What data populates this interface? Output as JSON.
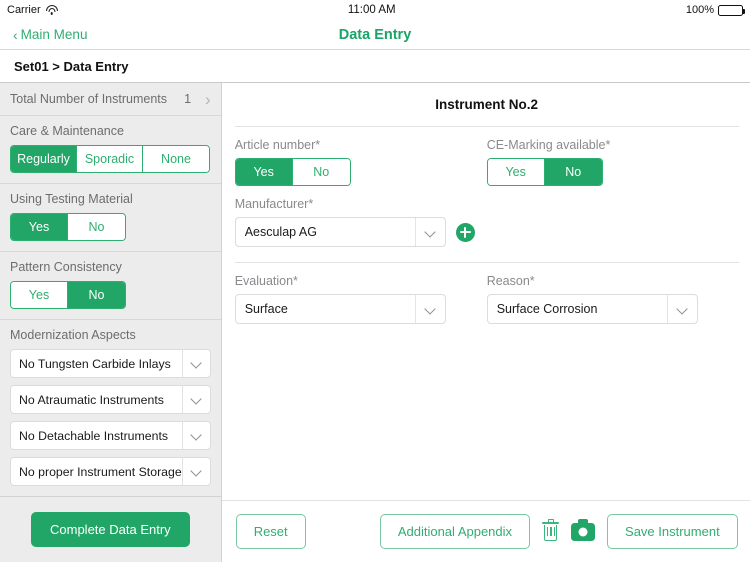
{
  "statusbar": {
    "carrier": "Carrier",
    "time": "11:00 AM",
    "battery_pct": "100%",
    "wifi_icon": "wifi-icon",
    "battery_icon": "battery-icon"
  },
  "navbar": {
    "back_chevron": "‹",
    "back_label": "Main Menu",
    "title": "Data Entry"
  },
  "breadcrumb": {
    "text": "Set01 > Data Entry"
  },
  "sidebar": {
    "instrument_count_row": {
      "label": "Total Number of Instruments",
      "value": "1",
      "chevron": "›"
    },
    "groups": [
      {
        "title": "Care & Maintenance",
        "type": "segmented-3",
        "options": [
          "Regularly",
          "Sporadic",
          "None"
        ],
        "selected": "Regularly"
      },
      {
        "title": "Using Testing Material",
        "type": "segmented-2",
        "options": [
          "Yes",
          "No"
        ],
        "selected": "Yes"
      },
      {
        "title": "Pattern Consistency",
        "type": "segmented-2",
        "options": [
          "Yes",
          "No"
        ],
        "selected": "No"
      },
      {
        "title": "Modernization Aspects",
        "type": "selects",
        "selects": [
          "No Tungsten Carbide Inlays",
          "No Atraumatic Instruments",
          "No Detachable Instruments",
          "No proper Instrument Storage"
        ]
      }
    ],
    "footer_button": "Complete Data Entry"
  },
  "main": {
    "panel_title": "Instrument No.2",
    "fields": {
      "article_number": {
        "label": "Article number*",
        "options": [
          "Yes",
          "No"
        ],
        "selected": "Yes"
      },
      "ce_marking": {
        "label": "CE-Marking available*",
        "options": [
          "Yes",
          "No"
        ],
        "selected": "No"
      },
      "manufacturer": {
        "label": "Manufacturer*",
        "value": "Aesculap AG",
        "add_icon": "plus-circle-icon"
      },
      "evaluation": {
        "label": "Evaluation*",
        "value": "Surface"
      },
      "reason": {
        "label": "Reason*",
        "value": "Surface Corrosion"
      }
    },
    "toolbar": {
      "reset": "Reset",
      "additional_appendix": "Additional Appendix",
      "delete_icon": "trash-icon",
      "camera_icon": "camera-icon",
      "save": "Save Instrument"
    }
  },
  "colors": {
    "accent_green": "#21A667",
    "accent_green_text": "#2FAE71",
    "title_green": "#18A566",
    "sidebar_bg": "#ececec",
    "label_grey": "#8a8a8e"
  }
}
